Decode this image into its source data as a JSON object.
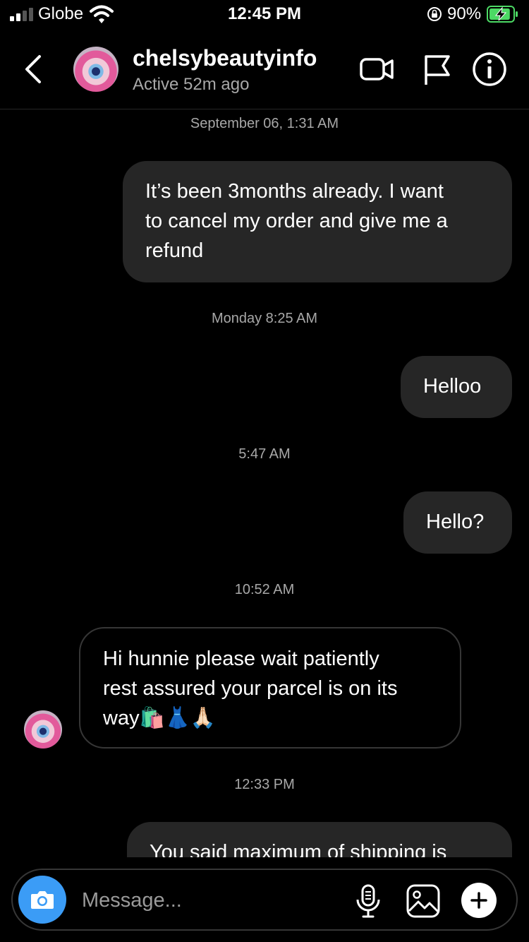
{
  "status_bar": {
    "carrier": "Globe",
    "time": "12:45 PM",
    "battery_percent": "90%",
    "signal_bars": 2,
    "battery_level": 0.9,
    "icons": [
      "signal-icon",
      "wifi-icon",
      "orientation-lock-icon",
      "battery-charging-icon"
    ]
  },
  "header": {
    "username": "chelsybeautyinfo",
    "status": "Active 52m ago",
    "icons": [
      "back-chevron-icon",
      "avatar",
      "video-call-icon",
      "flag-icon",
      "info-icon"
    ]
  },
  "thread": {
    "timestamps": [
      "September 06, 1:31 AM",
      "Monday 8:25 AM",
      "5:47 AM",
      "10:52 AM",
      "12:33 PM"
    ],
    "messages": [
      {
        "direction": "outgoing",
        "lines": [
          "It’s been 3months already. I want",
          "to cancel my order and give me a",
          "refund"
        ]
      },
      {
        "direction": "outgoing",
        "lines": [
          "Helloo"
        ]
      },
      {
        "direction": "outgoing",
        "lines": [
          "Hello?"
        ]
      },
      {
        "direction": "incoming",
        "lines": [
          "Hi hunnie please wait patiently",
          "rest assured your parcel is on its",
          "way🛍️👗🙏🏻"
        ]
      },
      {
        "direction": "outgoing",
        "lines": [
          "You said maximum of shipping is"
        ]
      }
    ]
  },
  "composer": {
    "placeholder": "Message...",
    "icons": [
      "camera-icon",
      "microphone-icon",
      "gallery-icon",
      "plus-icon"
    ]
  },
  "colors": {
    "background": "#000000",
    "outgoing_bubble": "#262626",
    "incoming_border": "#363636",
    "secondary_text": "#a8a8a8",
    "camera_button": "#3b9cf6",
    "battery_green": "#4cd964"
  }
}
